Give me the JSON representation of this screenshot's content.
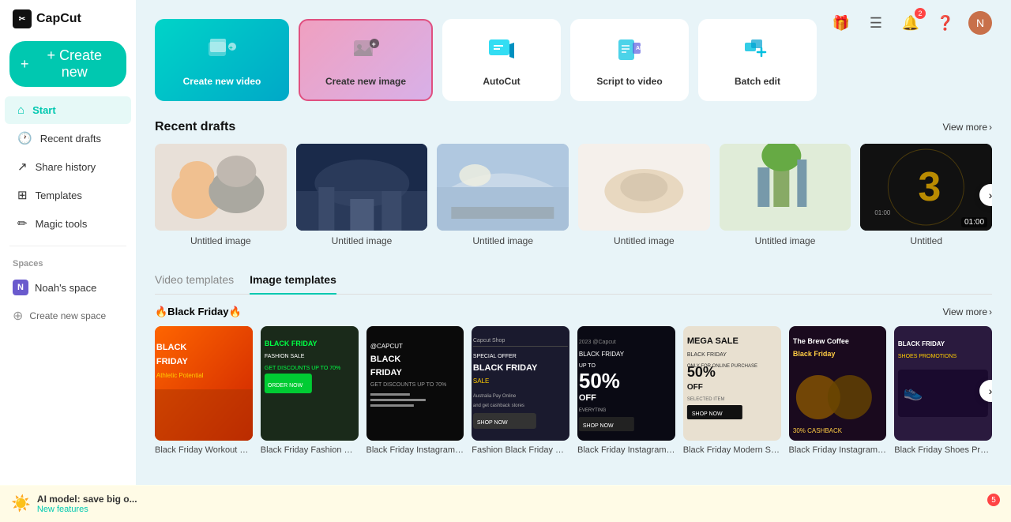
{
  "app": {
    "name": "CapCut",
    "logo_text": "✂"
  },
  "header": {
    "icons": [
      "gift",
      "list",
      "bell",
      "help",
      "avatar"
    ],
    "bell_count": "2"
  },
  "sidebar": {
    "create_label": "+ Create new",
    "nav_items": [
      {
        "id": "start",
        "label": "Start",
        "icon": "⌂",
        "active": true
      },
      {
        "id": "recent-drafts",
        "label": "Recent drafts",
        "icon": "🕐",
        "active": false
      },
      {
        "id": "share-history",
        "label": "Share history",
        "icon": "↗",
        "active": false
      },
      {
        "id": "templates",
        "label": "Templates",
        "icon": "⊞",
        "active": false
      },
      {
        "id": "magic-tools",
        "label": "Magic tools",
        "icon": "✏",
        "active": false
      }
    ],
    "spaces_label": "Spaces",
    "noah_space": "Noah's space",
    "create_space": "Create new space",
    "ai_badge_title": "AI model: save big o...",
    "ai_badge_sub": "New features"
  },
  "quick_actions": [
    {
      "id": "create-video",
      "label": "Create new video",
      "type": "video"
    },
    {
      "id": "create-image",
      "label": "Create new image",
      "type": "image"
    },
    {
      "id": "autocut",
      "label": "AutoCut",
      "type": "tool"
    },
    {
      "id": "script-to-video",
      "label": "Script to video",
      "type": "tool"
    },
    {
      "id": "batch-edit",
      "label": "Batch edit",
      "type": "tool"
    }
  ],
  "recent_drafts": {
    "title": "Recent drafts",
    "view_more": "View more",
    "items": [
      {
        "label": "Untitled image",
        "has_duration": false
      },
      {
        "label": "Untitled image",
        "has_duration": false
      },
      {
        "label": "Untitled image",
        "has_duration": false
      },
      {
        "label": "Untitled image",
        "has_duration": false
      },
      {
        "label": "Untitled image",
        "has_duration": false
      },
      {
        "label": "Untitled",
        "has_duration": true,
        "duration": "01:00"
      }
    ]
  },
  "templates": {
    "tabs": [
      {
        "id": "video",
        "label": "Video templates",
        "active": false
      },
      {
        "id": "image",
        "label": "Image templates",
        "active": true
      }
    ],
    "section_label": "🔥Black Friday🔥",
    "view_more": "View more",
    "items": [
      {
        "label": "Black Friday Workout & Fitnes...",
        "bg": "#e85500"
      },
      {
        "label": "Black Friday Fashion Sale Instagram Post",
        "bg": "#1a2a1a"
      },
      {
        "label": "Black Friday Instagram Story",
        "bg": "#0a0a0a"
      },
      {
        "label": "Fashion Black Friday Sale...",
        "bg": "#1a1a2e"
      },
      {
        "label": "Black Friday Instagram Story",
        "bg": "#111"
      },
      {
        "label": "Black Friday Modern Sale Instagram Post",
        "bg": "#e8e0d0"
      },
      {
        "label": "Black Friday Instagram Post",
        "bg": "#2a0a0a"
      },
      {
        "label": "Black Friday Shoes Promotions...",
        "bg": "#1a0a2e"
      }
    ]
  }
}
